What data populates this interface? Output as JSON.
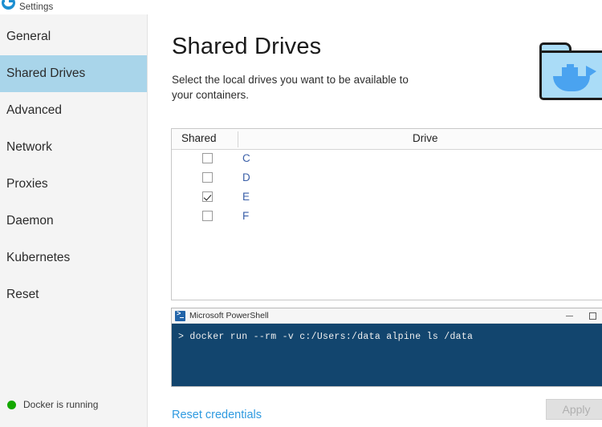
{
  "window": {
    "title": "Settings",
    "icon": "docker-whale-icon"
  },
  "sidebar": {
    "items": [
      {
        "label": "General",
        "selected": false
      },
      {
        "label": "Shared Drives",
        "selected": true
      },
      {
        "label": "Advanced",
        "selected": false
      },
      {
        "label": "Network",
        "selected": false
      },
      {
        "label": "Proxies",
        "selected": false
      },
      {
        "label": "Daemon",
        "selected": false
      },
      {
        "label": "Kubernetes",
        "selected": false
      },
      {
        "label": "Reset",
        "selected": false
      }
    ],
    "status": {
      "text": "Docker is running",
      "dot_color": "#14a800"
    },
    "selected_bg": "#a9d5ea"
  },
  "main": {
    "title": "Shared Drives",
    "subtitle": "Select the local drives you want to be available to your containers.",
    "illustration": "folder-with-docker-whale-icon",
    "table": {
      "headers": {
        "shared": "Shared",
        "drive": "Drive"
      },
      "rows": [
        {
          "drive": "C",
          "shared": false
        },
        {
          "drive": "D",
          "shared": false
        },
        {
          "drive": "E",
          "shared": true
        },
        {
          "drive": "F",
          "shared": false
        }
      ]
    },
    "terminal": {
      "title": "Microsoft PowerShell",
      "icon": "powershell-icon",
      "prompt": ">",
      "command": "docker run --rm -v c:/Users:/data alpine ls /data",
      "line": "> docker run --rm -v c:/Users:/data alpine ls /data",
      "bg_color": "#12456e",
      "controls": {
        "minimize": "—",
        "maximize": "□",
        "close": "✕"
      }
    },
    "reset_credentials_label": "Reset credentials",
    "apply_label": "Apply",
    "apply_enabled": false,
    "link_color": "#2f9ae0"
  }
}
